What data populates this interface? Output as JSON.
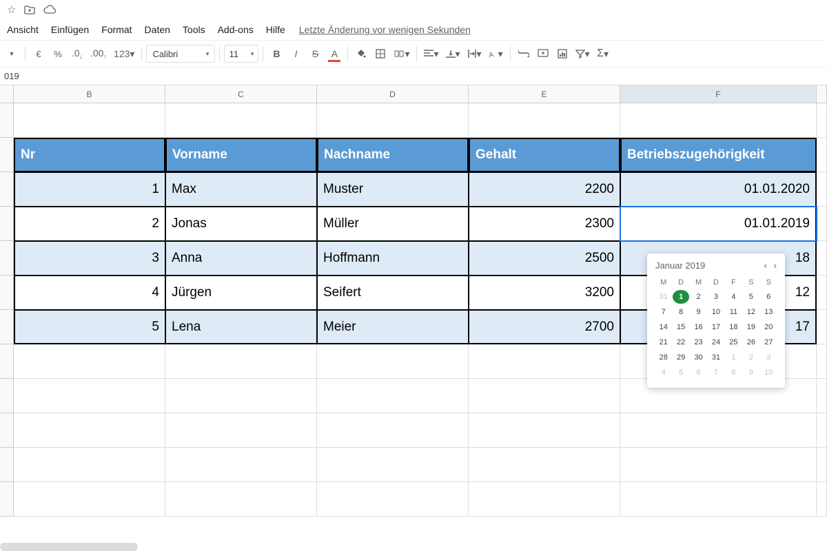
{
  "titlebar_icons": [
    "star",
    "folder",
    "cloud"
  ],
  "menu": [
    "Ansicht",
    "Einfügen",
    "Format",
    "Daten",
    "Tools",
    "Add-ons",
    "Hilfe"
  ],
  "last_edit": "Letzte Änderung vor wenigen Sekunden",
  "toolbar": {
    "currency": "€",
    "percent": "%",
    "dec_dec": ".0",
    "dec_inc": ".00",
    "num_fmt": "123",
    "font": "Calibri",
    "size": "11",
    "bold": "B",
    "italic": "I",
    "strike": "S",
    "text_color": "A"
  },
  "formula_value": "019",
  "columns": [
    "B",
    "C",
    "D",
    "E",
    "F"
  ],
  "selected_col": "F",
  "table": {
    "headers": [
      "Nr",
      "Vorname",
      "Nachname",
      "Gehalt",
      "Betriebszugehörigkeit"
    ],
    "rows": [
      {
        "nr": "1",
        "vor": "Max",
        "nach": "Muster",
        "gehalt": "2200",
        "datum": "01.01.2020"
      },
      {
        "nr": "2",
        "vor": "Jonas",
        "nach": "Müller",
        "gehalt": "2300",
        "datum": "01.01.2019"
      },
      {
        "nr": "3",
        "vor": "Anna",
        "nach": "Hoffmann",
        "gehalt": "2500",
        "datum": "18"
      },
      {
        "nr": "4",
        "vor": "Jürgen",
        "nach": "Seifert",
        "gehalt": "3200",
        "datum": "12"
      },
      {
        "nr": "5",
        "vor": "Lena",
        "nach": "Meier",
        "gehalt": "2700",
        "datum": "17"
      }
    ]
  },
  "datepicker": {
    "month": "Januar 2019",
    "dow": [
      "M",
      "D",
      "M",
      "D",
      "F",
      "S",
      "S"
    ],
    "weeks": [
      [
        {
          "d": "31",
          "o": true
        },
        {
          "d": "1",
          "sel": true
        },
        {
          "d": "2"
        },
        {
          "d": "3"
        },
        {
          "d": "4"
        },
        {
          "d": "5"
        },
        {
          "d": "6"
        }
      ],
      [
        {
          "d": "7"
        },
        {
          "d": "8"
        },
        {
          "d": "9"
        },
        {
          "d": "10"
        },
        {
          "d": "11"
        },
        {
          "d": "12"
        },
        {
          "d": "13"
        }
      ],
      [
        {
          "d": "14"
        },
        {
          "d": "15"
        },
        {
          "d": "16"
        },
        {
          "d": "17"
        },
        {
          "d": "18"
        },
        {
          "d": "19"
        },
        {
          "d": "20"
        }
      ],
      [
        {
          "d": "21"
        },
        {
          "d": "22"
        },
        {
          "d": "23"
        },
        {
          "d": "24"
        },
        {
          "d": "25"
        },
        {
          "d": "26"
        },
        {
          "d": "27"
        }
      ],
      [
        {
          "d": "28"
        },
        {
          "d": "29"
        },
        {
          "d": "30"
        },
        {
          "d": "31"
        },
        {
          "d": "1",
          "o": true
        },
        {
          "d": "2",
          "o": true
        },
        {
          "d": "3",
          "o": true
        }
      ],
      [
        {
          "d": "4",
          "o": true
        },
        {
          "d": "5",
          "o": true
        },
        {
          "d": "6",
          "o": true
        },
        {
          "d": "7",
          "o": true
        },
        {
          "d": "8",
          "o": true
        },
        {
          "d": "9",
          "o": true
        },
        {
          "d": "10",
          "o": true
        }
      ]
    ]
  }
}
